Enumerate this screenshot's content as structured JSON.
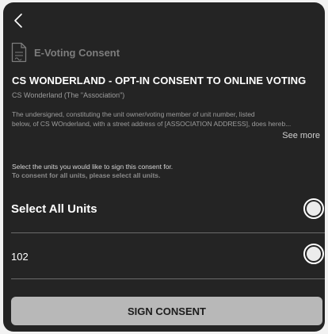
{
  "nav": {
    "back_icon": "chevron-left-icon"
  },
  "header": {
    "icon": "document-icon",
    "title": "E-Voting Consent"
  },
  "consent": {
    "title": "CS WONDERLAND - OPT-IN CONSENT TO ONLINE VOTING",
    "association": "CS Wonderland (The \"Association\")",
    "body_line_1": "The undersigned, constituting the unit owner/voting member of unit number, listed",
    "body_line_2": "below, of CS WOnderland, with a street address of [ASSOCIATION ADDRESS], does hereb...",
    "see_more_label": "See more"
  },
  "instructions": {
    "line_1": "Select the units you would like to sign this consent for.",
    "line_2": "To consent for all units,  please select all units."
  },
  "units": {
    "select_all_label": "Select All Units",
    "items": [
      {
        "label": "102"
      }
    ]
  },
  "actions": {
    "sign_label": "SIGN CONSENT"
  },
  "colors": {
    "background": "#242424",
    "button": "#b8b8b8",
    "muted_text": "#9c9c9c"
  }
}
